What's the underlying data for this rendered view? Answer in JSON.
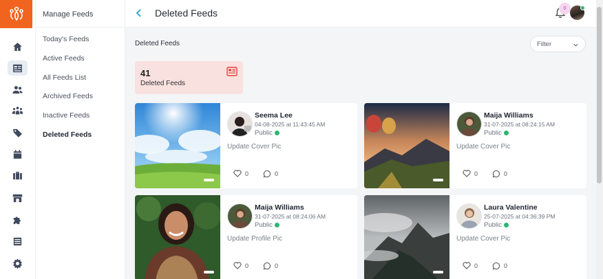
{
  "app": {
    "logo_icon": "people-logo-icon",
    "brand_color": "#f0641f"
  },
  "rail": [
    {
      "icon": "home-icon"
    },
    {
      "icon": "feeds-icon",
      "active": true
    },
    {
      "icon": "users-icon"
    },
    {
      "icon": "groups-icon"
    },
    {
      "icon": "tags-icon"
    },
    {
      "icon": "calendar-icon"
    },
    {
      "icon": "briefcase-icon"
    },
    {
      "icon": "store-icon"
    },
    {
      "icon": "puzzle-icon"
    },
    {
      "icon": "list-icon"
    },
    {
      "icon": "settings-icon"
    }
  ],
  "subnav": {
    "title": "Manage Feeds",
    "items": [
      {
        "label": "Today's Feeds"
      },
      {
        "label": "Active Feeds"
      },
      {
        "label": "All Feeds List"
      },
      {
        "label": "Archived Feeds"
      },
      {
        "label": "Inactive Feeds"
      },
      {
        "label": "Deleted Feeds",
        "active": true
      }
    ]
  },
  "header": {
    "title": "Deleted Feeds",
    "notifications": "0"
  },
  "content": {
    "section_title": "Deleted Feeds",
    "filter_label": "Filter",
    "stat": {
      "value": "41",
      "label": "Deleted Feeds"
    }
  },
  "cards": [
    {
      "name": "Seema Lee",
      "date": "04-08-2025 at 11:43:45 AM",
      "visibility": "Public",
      "text": "Update Cover Pic",
      "likes": "0",
      "comments": "0"
    },
    {
      "name": "Maija Williams",
      "date": "31-07-2025 at 08:24:15 AM",
      "visibility": "Public",
      "text": "Update Cover Pic",
      "likes": "0",
      "comments": "0"
    },
    {
      "name": "Maija Williams",
      "date": "31-07-2025 at 08:24:06 AM",
      "visibility": "Public",
      "text": "Update Profile Pic",
      "likes": "0",
      "comments": "0"
    },
    {
      "name": "Laura Valentine",
      "date": "25-07-2025 at 04:36:39 PM",
      "visibility": "Public",
      "text": "Update Cover Pic",
      "likes": "0",
      "comments": "0"
    }
  ]
}
